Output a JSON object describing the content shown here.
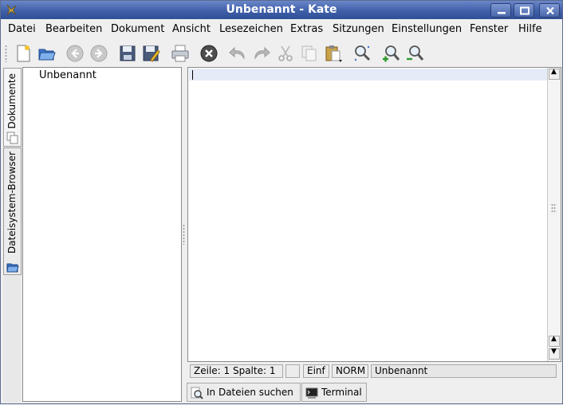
{
  "window": {
    "title": "Unbenannt - Kate"
  },
  "menu": [
    "Datei",
    "Bearbeiten",
    "Dokument",
    "Ansicht",
    "Lesezeichen",
    "Extras",
    "Sitzungen",
    "Einstellungen",
    "Fenster",
    "Hilfe"
  ],
  "toolbar": {
    "icons": [
      "new-document-icon",
      "open-folder-icon",
      "back-icon",
      "forward-icon",
      "save-icon",
      "save-as-icon",
      "print-icon",
      "close-document-icon",
      "undo-icon",
      "redo-icon",
      "cut-icon",
      "copy-icon",
      "paste-icon",
      "find-icon",
      "zoom-in-icon",
      "zoom-out-icon"
    ]
  },
  "sidetabs": {
    "documents": "Dokumente",
    "filesystem": "Dateisystem-Browser"
  },
  "doclist": {
    "items": [
      "Unbenannt"
    ]
  },
  "status": {
    "position": "Zeile: 1 Spalte: 1",
    "blank": "",
    "mode": "Einf",
    "input": "NORM",
    "filename": "Unbenannt"
  },
  "bottom_tabs": {
    "search": "In Dateien suchen",
    "terminal": "Terminal"
  },
  "colors": {
    "titlebar": "#3f5fa8",
    "current_line": "#e6ebf8"
  }
}
